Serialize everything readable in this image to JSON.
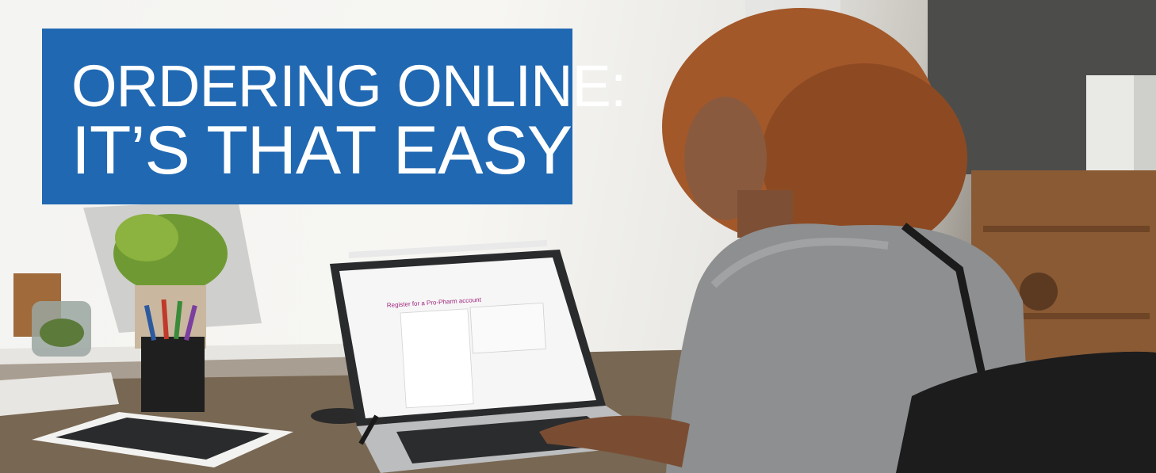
{
  "banner": {
    "line1": "ORDERING ONLINE:",
    "line2": "IT’S THAT EASY",
    "color": "#2068b2"
  },
  "photo": {
    "laptop_screen": {
      "heading": "Register for a Pro-Pharm account",
      "accent": "#a0267f"
    }
  },
  "colors": {
    "banner_blue": "#2068b2",
    "sweater": "#8e8f90",
    "hair": "#a3582a",
    "skin": "#8a5a3e",
    "desk": "#6b5a48"
  }
}
